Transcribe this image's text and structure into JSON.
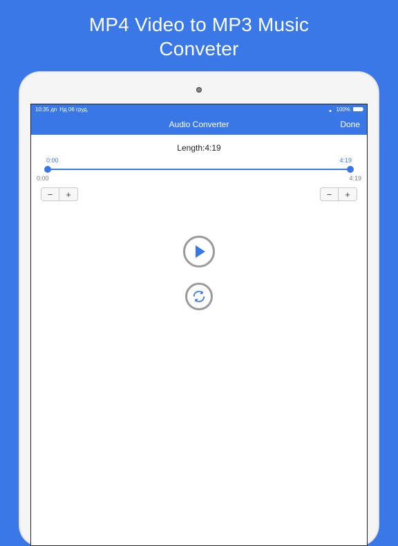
{
  "promo": {
    "line1": "MP4 Video to MP3 Music",
    "line2": "Conveter"
  },
  "statusbar": {
    "time": "10:35 дп",
    "date": "Нд 06 груд.",
    "battery_pct": "100%"
  },
  "navbar": {
    "title": "Audio Converter",
    "done": "Done"
  },
  "audio": {
    "length_label": "Length:",
    "length_value": "4:19",
    "trim_start_inner": "0:00",
    "trim_end_inner": "4:19",
    "outer_start": "0:00",
    "outer_end": "4:19"
  },
  "steppers": {
    "minus": "−",
    "plus": "+"
  }
}
